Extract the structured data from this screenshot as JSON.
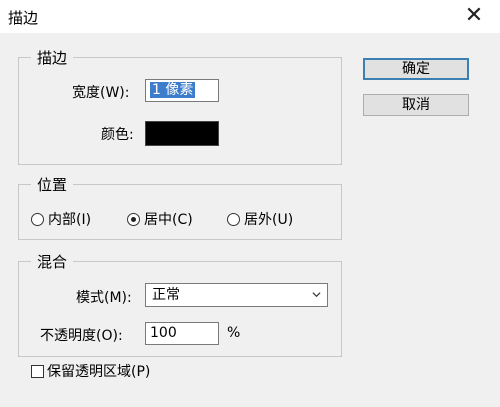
{
  "window": {
    "title": "描边",
    "close_glyph": "✕"
  },
  "stroke": {
    "group_label": "描边",
    "width_label": "宽度(W):",
    "width_value": "1 像素",
    "color_label": "颜色:",
    "color_value": "#000000"
  },
  "position": {
    "group_label": "位置",
    "options": [
      {
        "label": "内部(I)",
        "selected": false
      },
      {
        "label": "居中(C)",
        "selected": true
      },
      {
        "label": "居外(U)",
        "selected": false
      }
    ]
  },
  "blend": {
    "group_label": "混合",
    "mode_label": "模式(M):",
    "mode_value": "正常",
    "opacity_label": "不透明度(O):",
    "opacity_value": "100",
    "opacity_unit": "%",
    "preserve_label": "保留透明区域(P)",
    "preserve_checked": false
  },
  "buttons": {
    "ok": "确定",
    "cancel": "取消"
  },
  "colors": {
    "accent": "#3c7fb1",
    "selection": "#3d7dcc"
  }
}
